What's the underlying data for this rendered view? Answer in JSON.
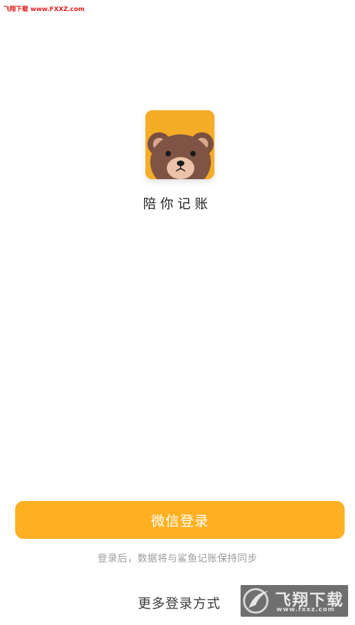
{
  "watermark": {
    "top_text": "飞翔下载 www.FXXZ.com",
    "badge_title": "飞翔下载",
    "badge_url": "www.fxxz.com"
  },
  "app": {
    "name": "陪你记账",
    "logo_icon": "bear-face-icon",
    "logo_bg": "#f5ac27"
  },
  "login": {
    "wechat_button": "微信登录",
    "sync_hint": "登录后，数据将与鲨鱼记账保持同步",
    "more_methods": "更多登录方式",
    "accent": "#ffb022"
  }
}
